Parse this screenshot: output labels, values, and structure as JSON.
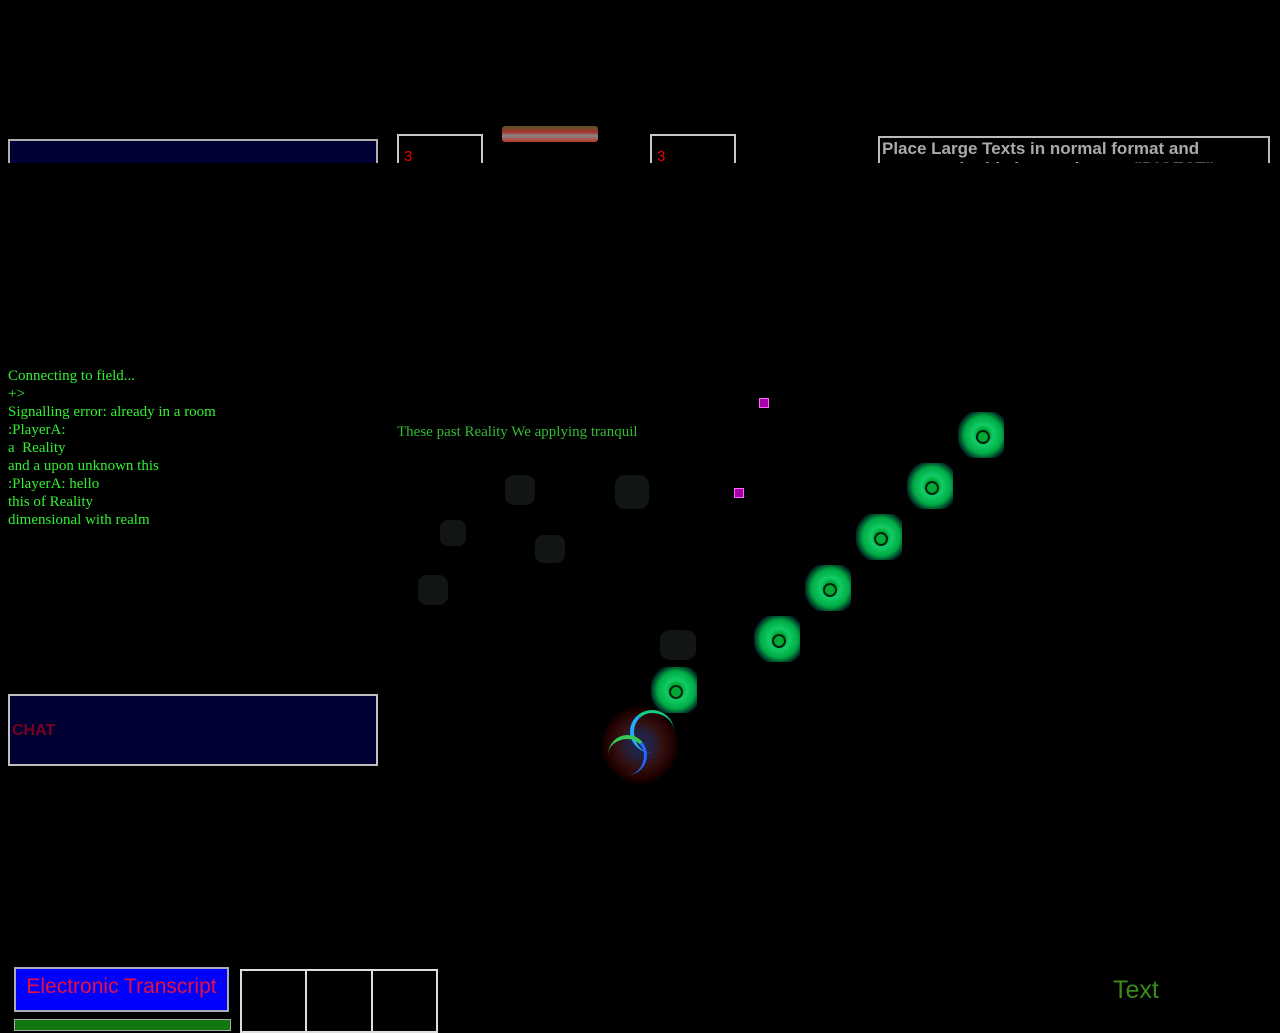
{
  "top": {
    "counter_left": "3",
    "counter_right": "3",
    "digest_placeholder": "Place Large Texts in normal format and grammer in this box and press \"DIGEST\" to"
  },
  "log": {
    "lines": [
      "Connecting to field...",
      "+>",
      "Signalling error: already in a room",
      ":PlayerA:",
      "a  Reality",
      "and a upon unknown this",
      ":PlayerA: hello",
      "this of Reality",
      "dimensional with realm"
    ]
  },
  "scene": {
    "caption": "These past Reality We applying tranquil"
  },
  "chat": {
    "label": "CHAT"
  },
  "bottom": {
    "transcript_button": "Electronic Transcript",
    "text_label": "Text"
  },
  "colors": {
    "log_text": "#33ee33",
    "panel_bg": "#000033",
    "button_blue": "#0000ff",
    "button_text": "#e8103a"
  }
}
